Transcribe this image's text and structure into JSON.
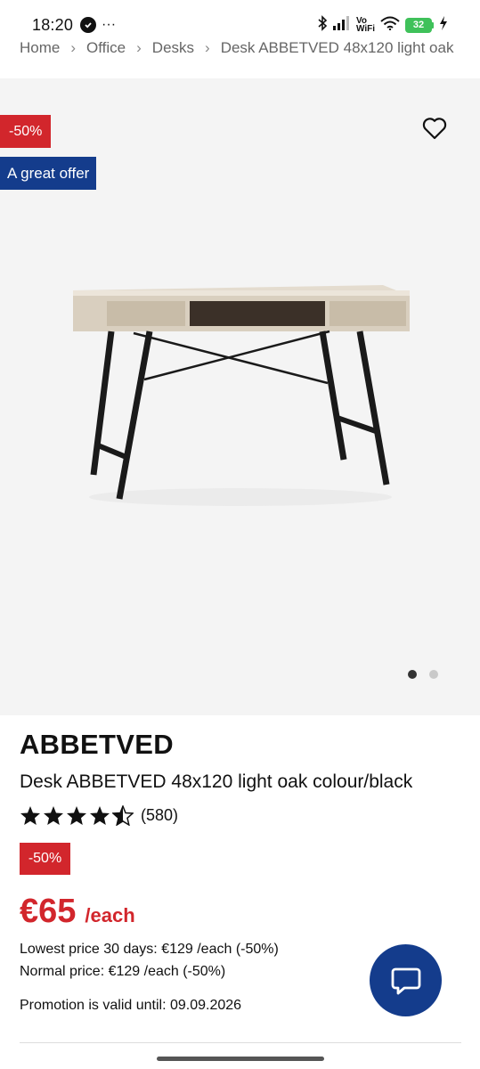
{
  "status_bar": {
    "time": "18:20",
    "more": "···",
    "network_top": "Vo",
    "network_bottom": "WiFi",
    "battery": "32"
  },
  "breadcrumb": {
    "items": [
      "Home",
      "Office",
      "Desks",
      "Desk ABBETVED 48x120 light oak"
    ],
    "separator": "›"
  },
  "gallery": {
    "discount_badge": "-50%",
    "offer_badge": "A great offer",
    "slide_count": 2,
    "active_slide": 1
  },
  "product": {
    "brand": "ABBETVED",
    "description": "Desk ABBETVED 48x120 light oak colour/black",
    "rating_value": 4.5,
    "rating_count": "(580)",
    "discount_badge": "-50%",
    "price": "€65",
    "price_unit": "/each",
    "lowest_price": "Lowest price 30 days: €129 /each (-50%)",
    "normal_price": "Normal price: €129 /each (-50%)",
    "promotion": "Promotion is valid until: 09.09.2026"
  },
  "colors": {
    "discount_red": "#d2262c",
    "brand_blue": "#143c8c",
    "gallery_bg": "#f4f4f4"
  },
  "icons": {
    "favorite": "heart-outline-icon",
    "chat": "chat-bubble-icon",
    "star": "star-icon"
  }
}
